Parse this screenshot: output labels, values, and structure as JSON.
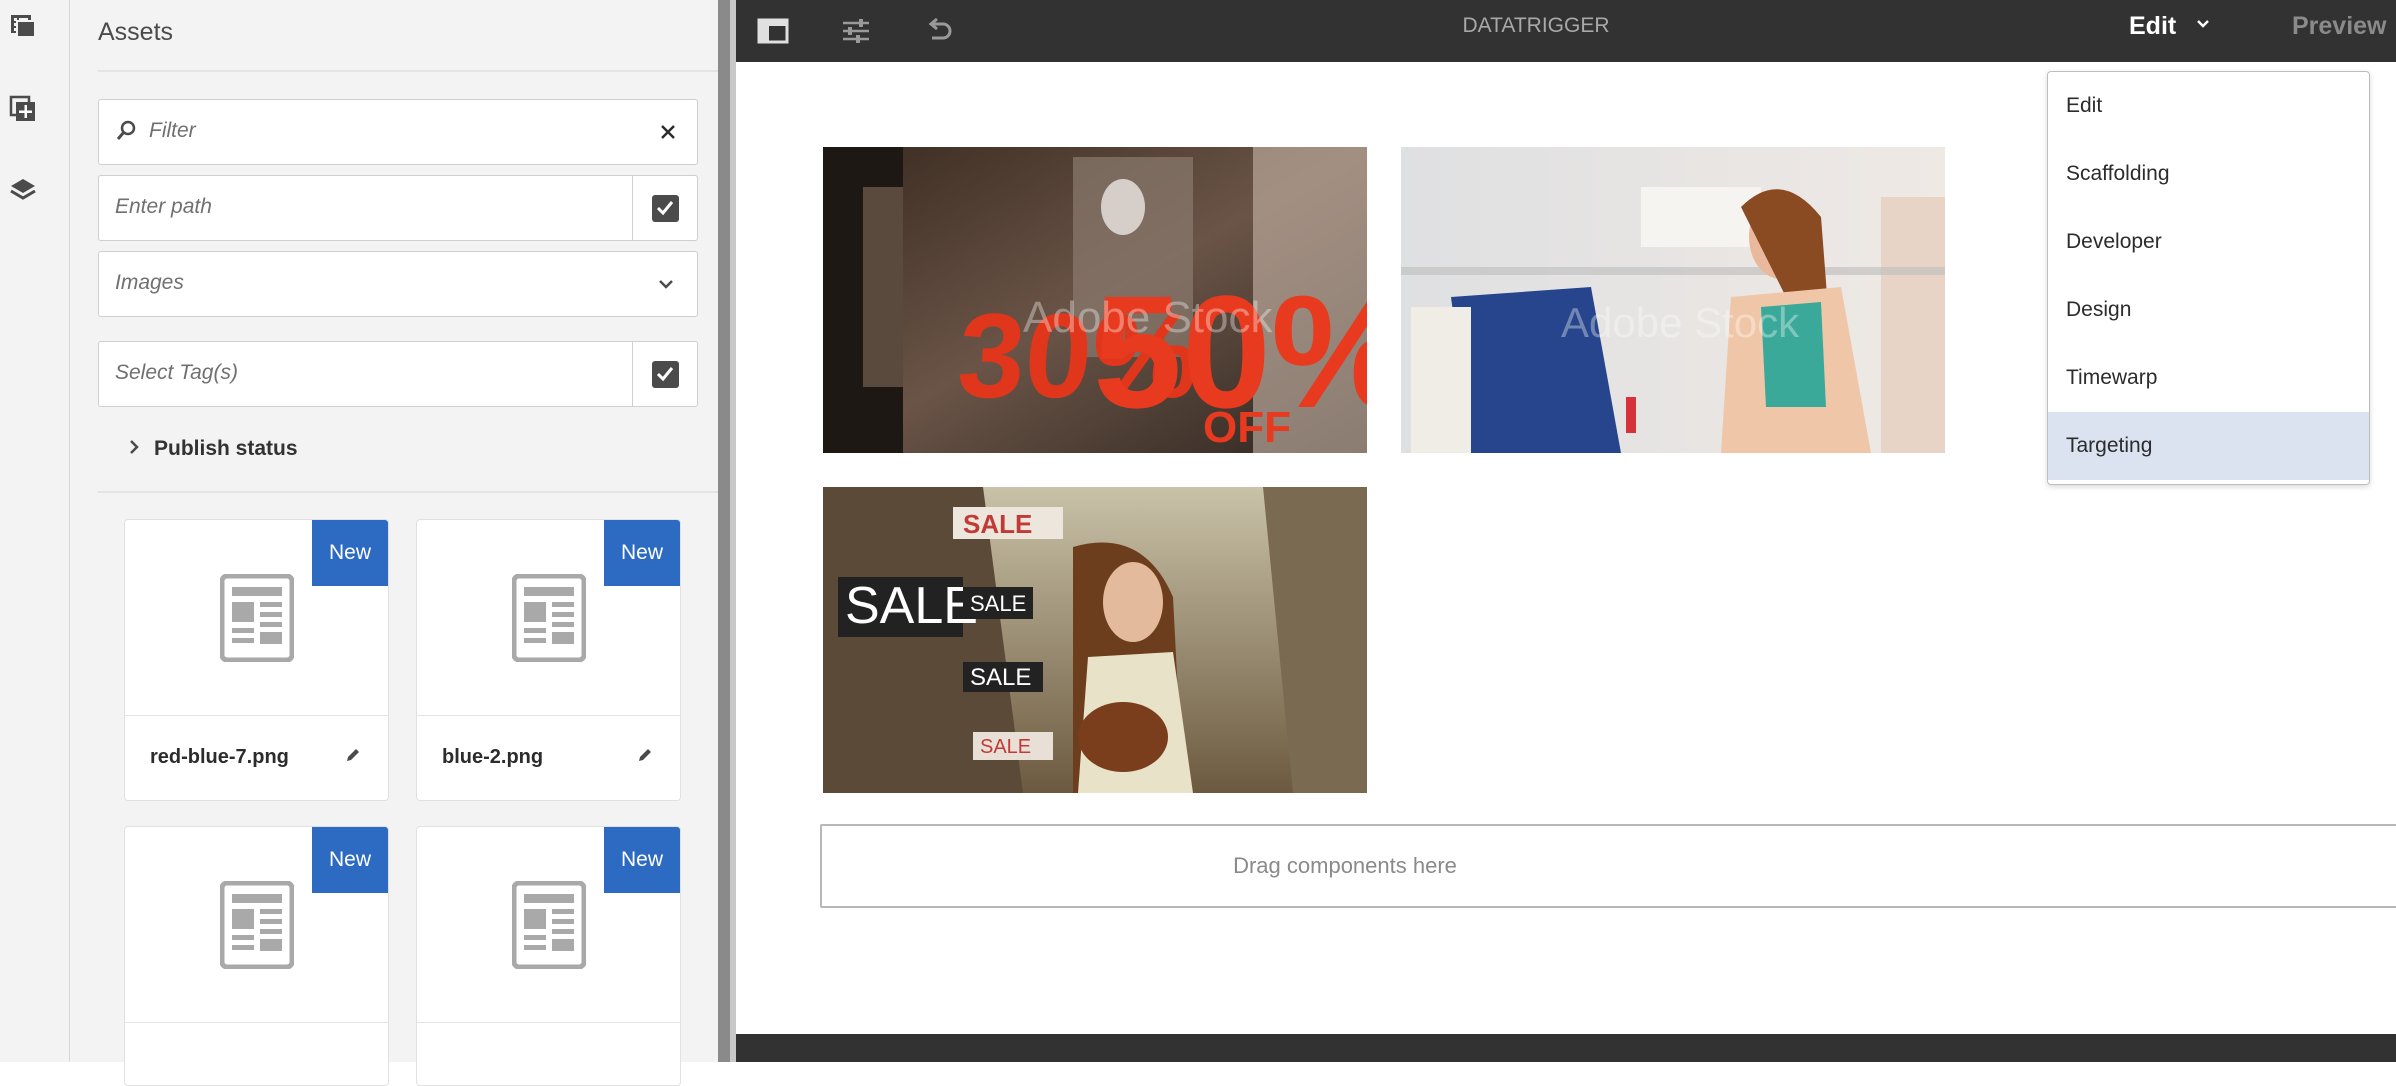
{
  "assets_panel": {
    "title": "Assets",
    "filter_placeholder": "Filter",
    "path_placeholder": "Enter path",
    "type_select": "Images",
    "tags_placeholder": "Select Tag(s)",
    "publish_status": "Publish status",
    "badge": "New",
    "items": [
      {
        "name": "red-blue-7.png"
      },
      {
        "name": "blue-2.png"
      },
      {
        "name": ""
      },
      {
        "name": ""
      }
    ]
  },
  "editor": {
    "page_title": "DATATRIGGER",
    "mode_label": "Edit",
    "preview_label": "Preview",
    "dropzone": "Drag components here",
    "watermark": "Adobe Stock",
    "sale_text": "SALE",
    "discount_30": "30%",
    "discount_50": "50%",
    "off_text": "OFF"
  },
  "mode_menu": {
    "items": [
      "Edit",
      "Scaffolding",
      "Developer",
      "Design",
      "Timewarp",
      "Targeting"
    ],
    "selected": "Targeting"
  },
  "colors": {
    "badge": "#2d6ac1",
    "topbar": "#323232",
    "selected_menu": "#dbe3f0"
  },
  "icons": {
    "rail": [
      "filmstrip-icon",
      "add-component-icon",
      "layers-icon"
    ],
    "toolbar": [
      "side-panel-icon",
      "page-properties-icon",
      "undo-icon"
    ]
  }
}
